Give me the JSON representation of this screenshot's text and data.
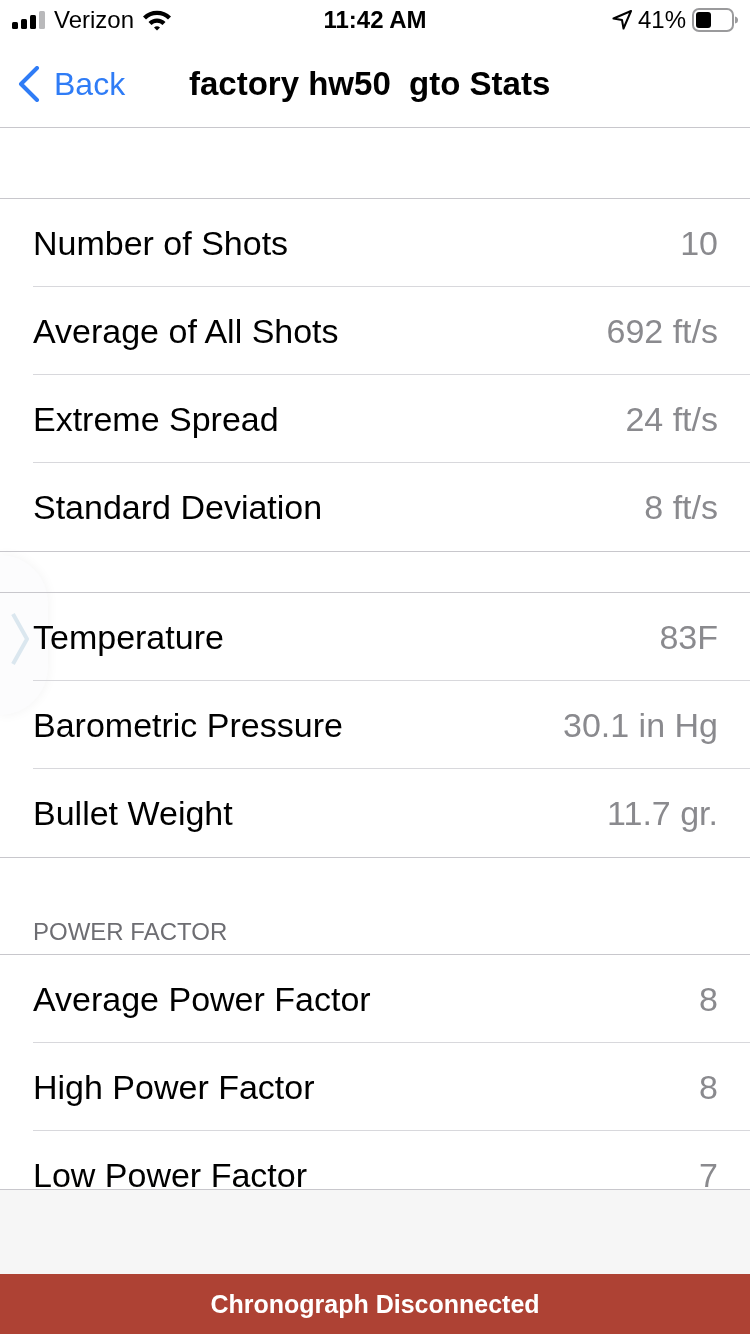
{
  "status_bar": {
    "carrier": "Verizon",
    "time": "11:42 AM",
    "battery": "41%"
  },
  "nav_bar": {
    "back": "Back",
    "title": "factory hw50  gto Stats"
  },
  "sections": [
    {
      "rows": [
        {
          "label": "Number of Shots",
          "value": "10"
        },
        {
          "label": "Average of All Shots",
          "value": "692 ft/s"
        },
        {
          "label": "Extreme Spread",
          "value": "24 ft/s"
        },
        {
          "label": "Standard Deviation",
          "value": "8 ft/s"
        }
      ]
    },
    {
      "rows": [
        {
          "label": "Temperature",
          "value": "83F"
        },
        {
          "label": "Barometric Pressure",
          "value": "30.1 in Hg"
        },
        {
          "label": "Bullet Weight",
          "value": "11.7 gr."
        }
      ]
    },
    {
      "header": "POWER FACTOR",
      "rows": [
        {
          "label": "Average Power Factor",
          "value": "8"
        },
        {
          "label": "High Power Factor",
          "value": "8"
        },
        {
          "label": "Low Power Factor",
          "value": "7"
        }
      ]
    }
  ],
  "banner": {
    "text": "Chronograph Disconnected"
  }
}
